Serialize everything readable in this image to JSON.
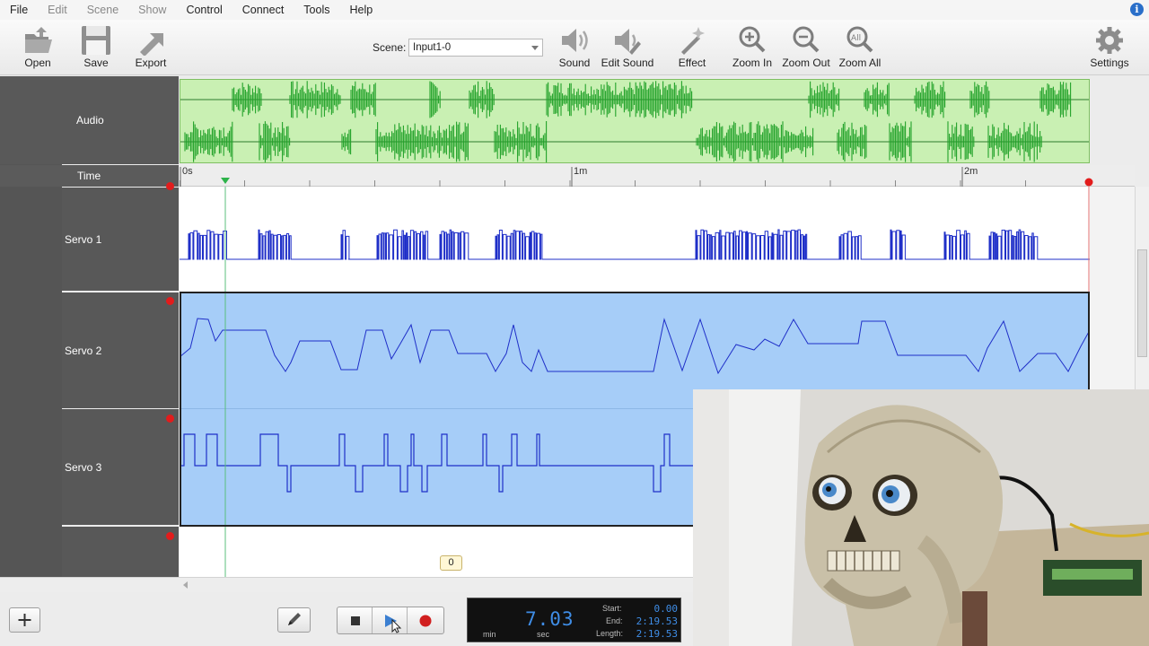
{
  "menu": {
    "items": [
      {
        "label": "File",
        "enabled": true
      },
      {
        "label": "Edit",
        "enabled": false
      },
      {
        "label": "Scene",
        "enabled": false
      },
      {
        "label": "Show",
        "enabled": false
      },
      {
        "label": "Control",
        "enabled": true
      },
      {
        "label": "Connect",
        "enabled": true
      },
      {
        "label": "Tools",
        "enabled": true
      },
      {
        "label": "Help",
        "enabled": true
      }
    ],
    "info_icon": "i"
  },
  "toolbar": {
    "open": "Open",
    "save": "Save",
    "export": "Export",
    "scene_label": "Scene:",
    "scene_value": "Input1-0",
    "sound": "Sound",
    "edit_sound": "Edit Sound",
    "effect": "Effect",
    "zoom_in": "Zoom In",
    "zoom_out": "Zoom Out",
    "zoom_all": "Zoom All",
    "settings": "Settings"
  },
  "timeline": {
    "audio_label": "Audio",
    "time_label": "Time",
    "ruler_ticks": [
      "0s",
      "1m",
      "2m"
    ],
    "tracks": [
      {
        "label": "Servo 1",
        "armed": false
      },
      {
        "label": "Servo 2",
        "armed": true
      },
      {
        "label": "Servo 3",
        "armed": true
      },
      {
        "label": "",
        "armed": true
      }
    ],
    "marker_count": "0"
  },
  "transport": {
    "time_display": "7.03",
    "min_label": "min",
    "sec_label": "sec",
    "start_label": "Start:",
    "start_value": "0.00",
    "end_label": "End:",
    "end_value": "2:19.53",
    "length_label": "Length:",
    "length_value": "2:19.53"
  },
  "colors": {
    "audio_wave": "#22a22a",
    "audio_bg": "#c9f0b3",
    "servo_line": "#1f2fc8",
    "selection_bg": "#a6cdf8",
    "record_red": "#e21c1c",
    "lcd_digits": "#3f8de6"
  }
}
